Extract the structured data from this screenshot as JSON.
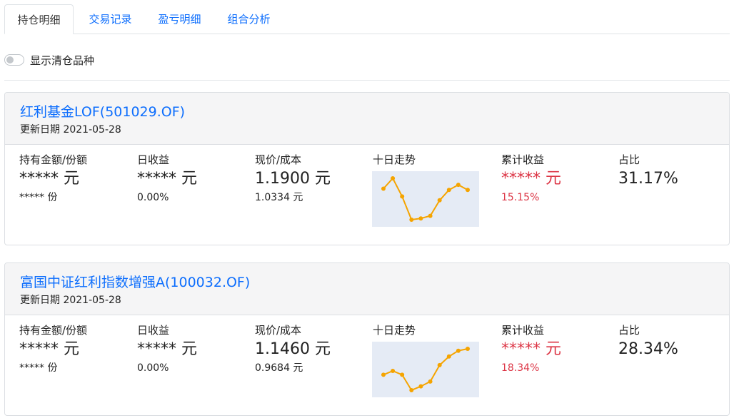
{
  "tabs": [
    {
      "label": "持仓明细",
      "active": true
    },
    {
      "label": "交易记录",
      "active": false
    },
    {
      "label": "盈亏明细",
      "active": false
    },
    {
      "label": "组合分析",
      "active": false
    }
  ],
  "toggle": {
    "label": "显示清仓品种",
    "checked": false
  },
  "colors": {
    "accent": "#0d6efd",
    "profit": "#dc3545",
    "spark_line": "#f5a400",
    "spark_bg": "#e5ebf5"
  },
  "funds": [
    {
      "name": "红利基金LOF(501029.OF)",
      "update": "更新日期 2021-05-28",
      "holding": {
        "label": "持有金额/份额",
        "amount": "***** 元",
        "shares": "***** 份"
      },
      "daily": {
        "label": "日收益",
        "amount": "***** 元",
        "pct": "0.00%"
      },
      "price": {
        "label": "现价/成本",
        "current": "1.1900 元",
        "cost": "1.0334 元"
      },
      "trend": {
        "label": "十日走势",
        "values": [
          1.186,
          1.194,
          1.18,
          1.162,
          1.163,
          1.165,
          1.177,
          1.185,
          1.189,
          1.185
        ]
      },
      "total": {
        "label": "累计收益",
        "amount": "***** 元",
        "pct": "15.15%"
      },
      "ratio": {
        "label": "占比",
        "value": "31.17%"
      }
    },
    {
      "name": "富国中证红利指数增强A(100032.OF)",
      "update": "更新日期 2021-05-28",
      "holding": {
        "label": "持有金额/份额",
        "amount": "***** 元",
        "shares": "***** 份"
      },
      "daily": {
        "label": "日收益",
        "amount": "***** 元",
        "pct": "0.00%"
      },
      "price": {
        "label": "现价/成本",
        "current": "1.1460 元",
        "cost": "0.9684 元"
      },
      "trend": {
        "label": "十日走势",
        "values": [
          1.117,
          1.121,
          1.117,
          1.101,
          1.105,
          1.11,
          1.127,
          1.136,
          1.142,
          1.144
        ]
      },
      "total": {
        "label": "累计收益",
        "amount": "***** 元",
        "pct": "18.34%"
      },
      "ratio": {
        "label": "占比",
        "value": "28.34%"
      }
    }
  ]
}
